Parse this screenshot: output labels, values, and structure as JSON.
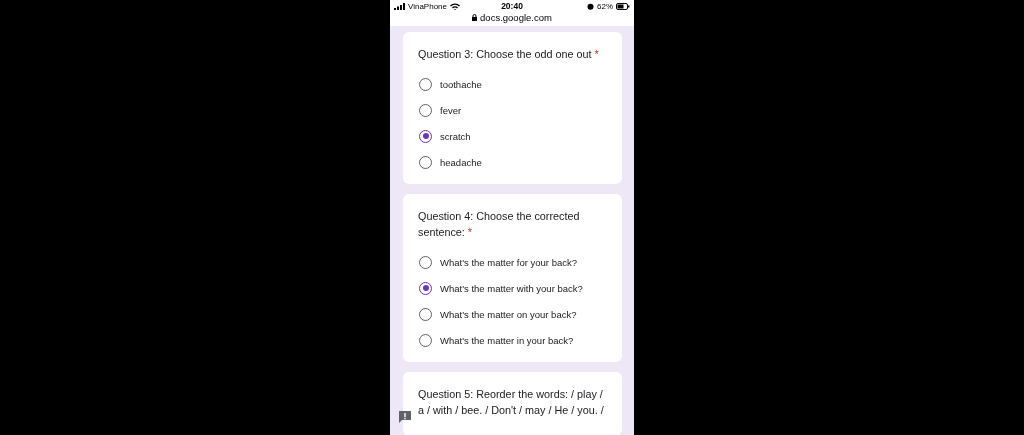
{
  "status_bar": {
    "carrier": "VinaPhone",
    "time": "20:40",
    "battery": "62%",
    "url": "docs.google.com"
  },
  "questions": [
    {
      "title": "Question 3: Choose the odd one out",
      "required_mark": "*",
      "options": [
        {
          "label": "toothache",
          "selected": false
        },
        {
          "label": "fever",
          "selected": false
        },
        {
          "label": "scratch",
          "selected": true
        },
        {
          "label": "headache",
          "selected": false
        }
      ]
    },
    {
      "title": "Question 4: Choose the corrected sentence:",
      "required_mark": "*",
      "options": [
        {
          "label": "What's the matter for your back?",
          "selected": false
        },
        {
          "label": "What's the matter with your back?",
          "selected": true
        },
        {
          "label": "What's the matter on your back?",
          "selected": false
        },
        {
          "label": "What's the matter in your back?",
          "selected": false
        }
      ]
    },
    {
      "title": "Question 5: Reorder the words: / play / a / with / bee. / Don't / may / He / you. /"
    }
  ]
}
